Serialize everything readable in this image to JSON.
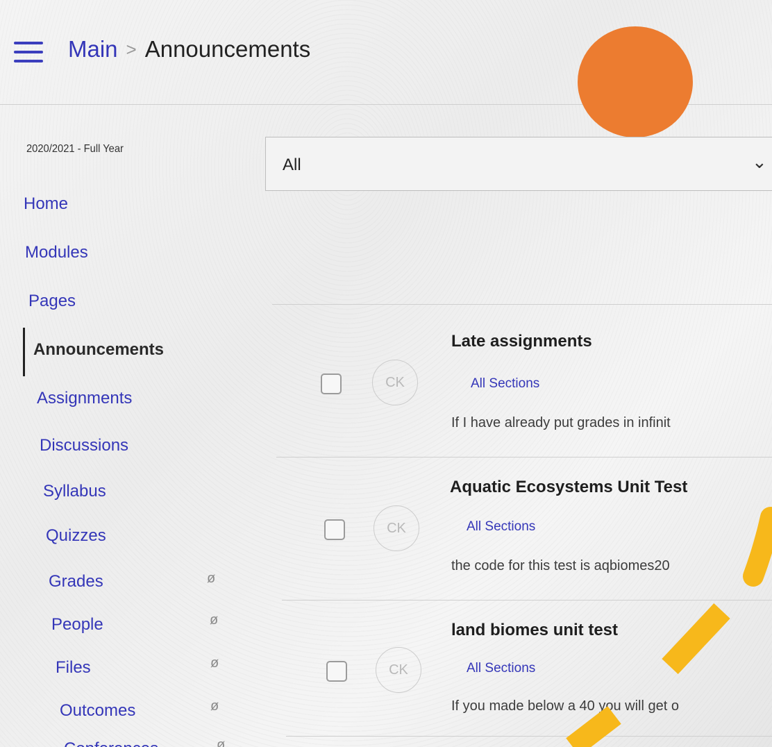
{
  "breadcrumb": {
    "root": "Main",
    "separator": ">",
    "current": "Announcements"
  },
  "term": "2020/2021 - Full Year",
  "filter": {
    "value": "All"
  },
  "nav": [
    {
      "label": "Home"
    },
    {
      "label": "Modules"
    },
    {
      "label": "Pages"
    },
    {
      "label": "Announcements",
      "active": true
    },
    {
      "label": "Assignments"
    },
    {
      "label": "Discussions"
    },
    {
      "label": "Syllabus"
    },
    {
      "label": "Quizzes"
    },
    {
      "label": "Grades",
      "hidden_icon": "eye-slash-icon"
    },
    {
      "label": "People",
      "hidden_icon": "eye-slash-icon"
    },
    {
      "label": "Files",
      "hidden_icon": "eye-slash-icon"
    },
    {
      "label": "Outcomes",
      "hidden_icon": "eye-slash-icon"
    },
    {
      "label": "Conferences",
      "hidden_icon": "eye-slash-icon"
    }
  ],
  "announcements": [
    {
      "title": "Late assignments",
      "avatar": "CK",
      "section": "All Sections",
      "snippet": "If I have already put grades in infinit"
    },
    {
      "title": "Aquatic Ecosystems Unit Test",
      "avatar": "CK",
      "section": "All Sections",
      "snippet": "the code for this test is aqbiomes20"
    },
    {
      "title": "land biomes unit test",
      "avatar": "CK",
      "section": "All Sections",
      "snippet": "If you made below a 40 you will get o"
    }
  ],
  "colors": {
    "link": "#3436b8",
    "overlay_dot": "#ec7c30",
    "overlay_stroke": "#f7b81b"
  },
  "icons": {
    "menu": "hamburger-icon",
    "dropdown": "chevron-down-icon",
    "hidden": "eye-slash-icon"
  }
}
